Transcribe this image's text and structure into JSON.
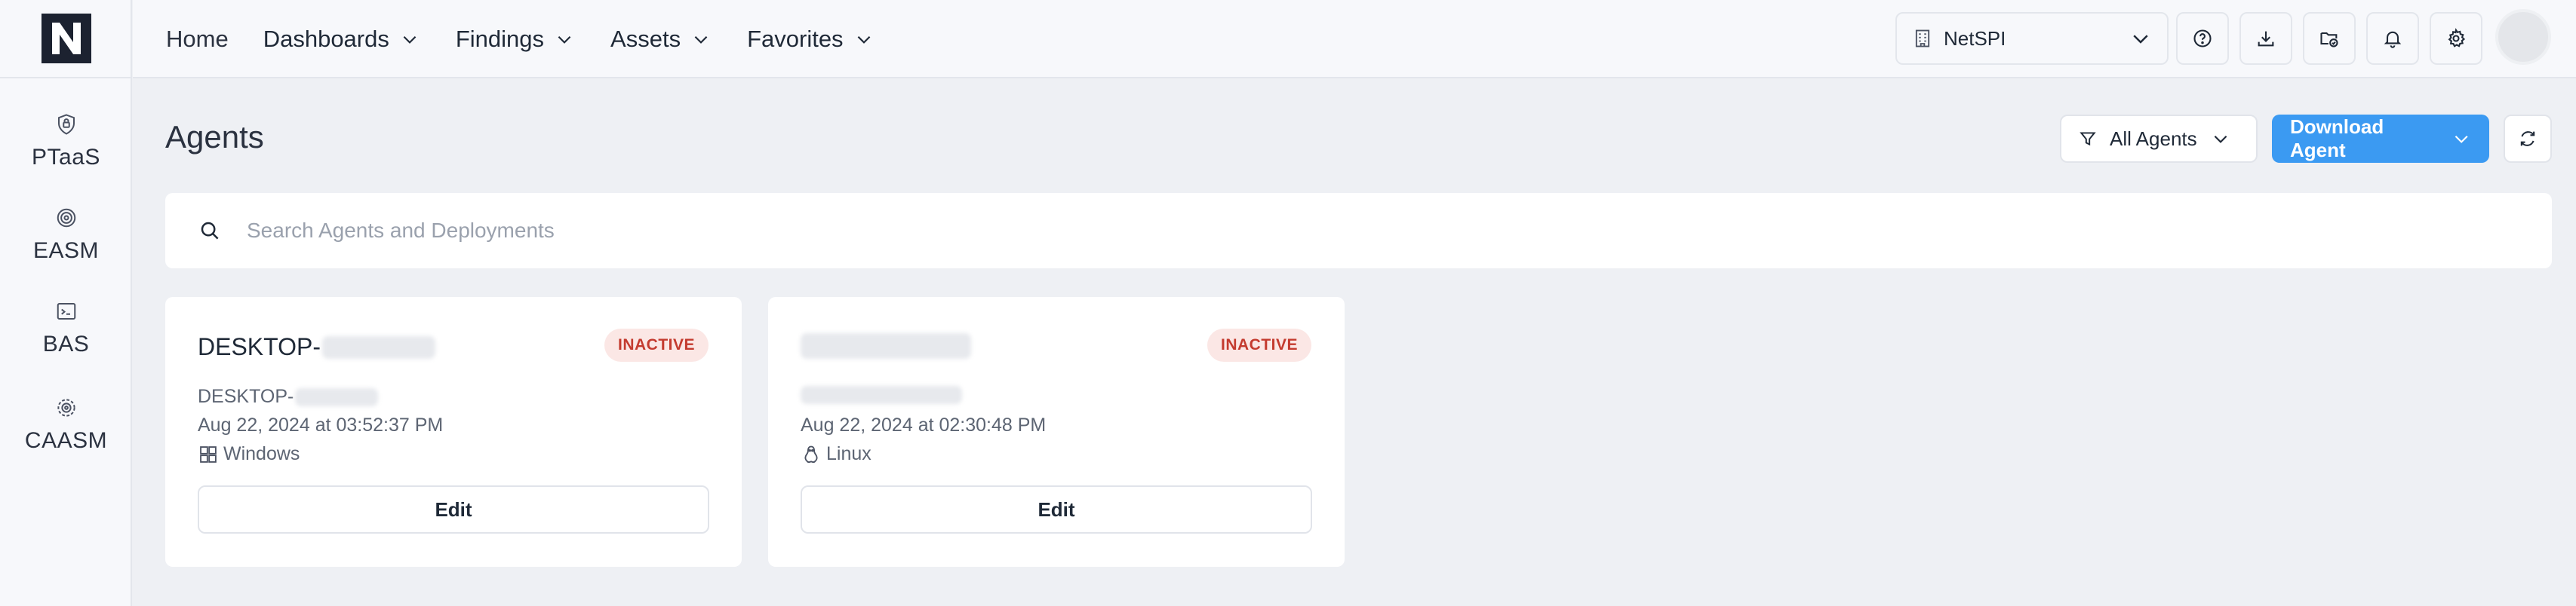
{
  "brand": {
    "logo_icon": "netspi-logo-icon"
  },
  "sidebar": {
    "items": [
      {
        "label": "PTaaS",
        "icon": "shield-lock-icon"
      },
      {
        "label": "EASM",
        "icon": "target-icon"
      },
      {
        "label": "BAS",
        "icon": "terminal-window-icon"
      },
      {
        "label": "CAASM",
        "icon": "gear-network-icon"
      }
    ]
  },
  "nav": {
    "home": "Home",
    "dashboards": "Dashboards",
    "findings": "Findings",
    "assets": "Assets",
    "favorites": "Favorites"
  },
  "header": {
    "tenant": "NetSPI",
    "icons": [
      "help-icon",
      "download-icon",
      "folder-sync-icon",
      "bell-icon",
      "gear-icon"
    ]
  },
  "page": {
    "title": "Agents",
    "filter_label": "All Agents",
    "download_label": "Download Agent",
    "search_placeholder": "Search Agents and Deployments"
  },
  "colors": {
    "primary": "#3b9af2",
    "inactive_text": "#c43b2f",
    "inactive_bg": "#fbe7e5",
    "background": "#eef0f4"
  },
  "agents": [
    {
      "name": "DESKTOP-",
      "status": "INACTIVE",
      "host": "DESKTOP-",
      "timestamp": "Aug 22, 2024 at 03:52:37 PM",
      "os": "Windows",
      "os_icon": "windows-icon",
      "action": "Edit"
    },
    {
      "name": "",
      "status": "INACTIVE",
      "host": "",
      "timestamp": "Aug 22, 2024 at 02:30:48 PM",
      "os": "Linux",
      "os_icon": "linux-icon",
      "action": "Edit"
    }
  ]
}
